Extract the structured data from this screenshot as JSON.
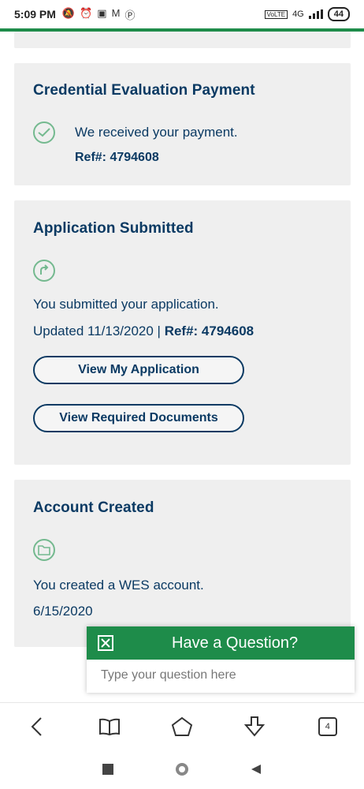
{
  "status_bar": {
    "time": "5:09 PM",
    "network": "4G",
    "battery": "44"
  },
  "cards": {
    "payment": {
      "title": "Credential Evaluation Payment",
      "message": "We received your payment.",
      "ref": "Ref#: 4794608"
    },
    "application": {
      "title": "Application Submitted",
      "message": "You submitted your application.",
      "updated": "Updated 11/13/2020 |",
      "ref": "Ref#: 4794608",
      "view_application_label": "View My Application",
      "view_documents_label": "View Required Documents"
    },
    "account": {
      "title": "Account Created",
      "message": "You created a WES account.",
      "date": "6/15/2020"
    }
  },
  "chat": {
    "title": "Have a Question?",
    "placeholder": "Type your question here"
  },
  "browser_nav": {
    "tab_count": "4"
  },
  "colors": {
    "accent_green": "#1e8c4a",
    "navy": "#0b3a63",
    "card_bg": "#efefef"
  }
}
